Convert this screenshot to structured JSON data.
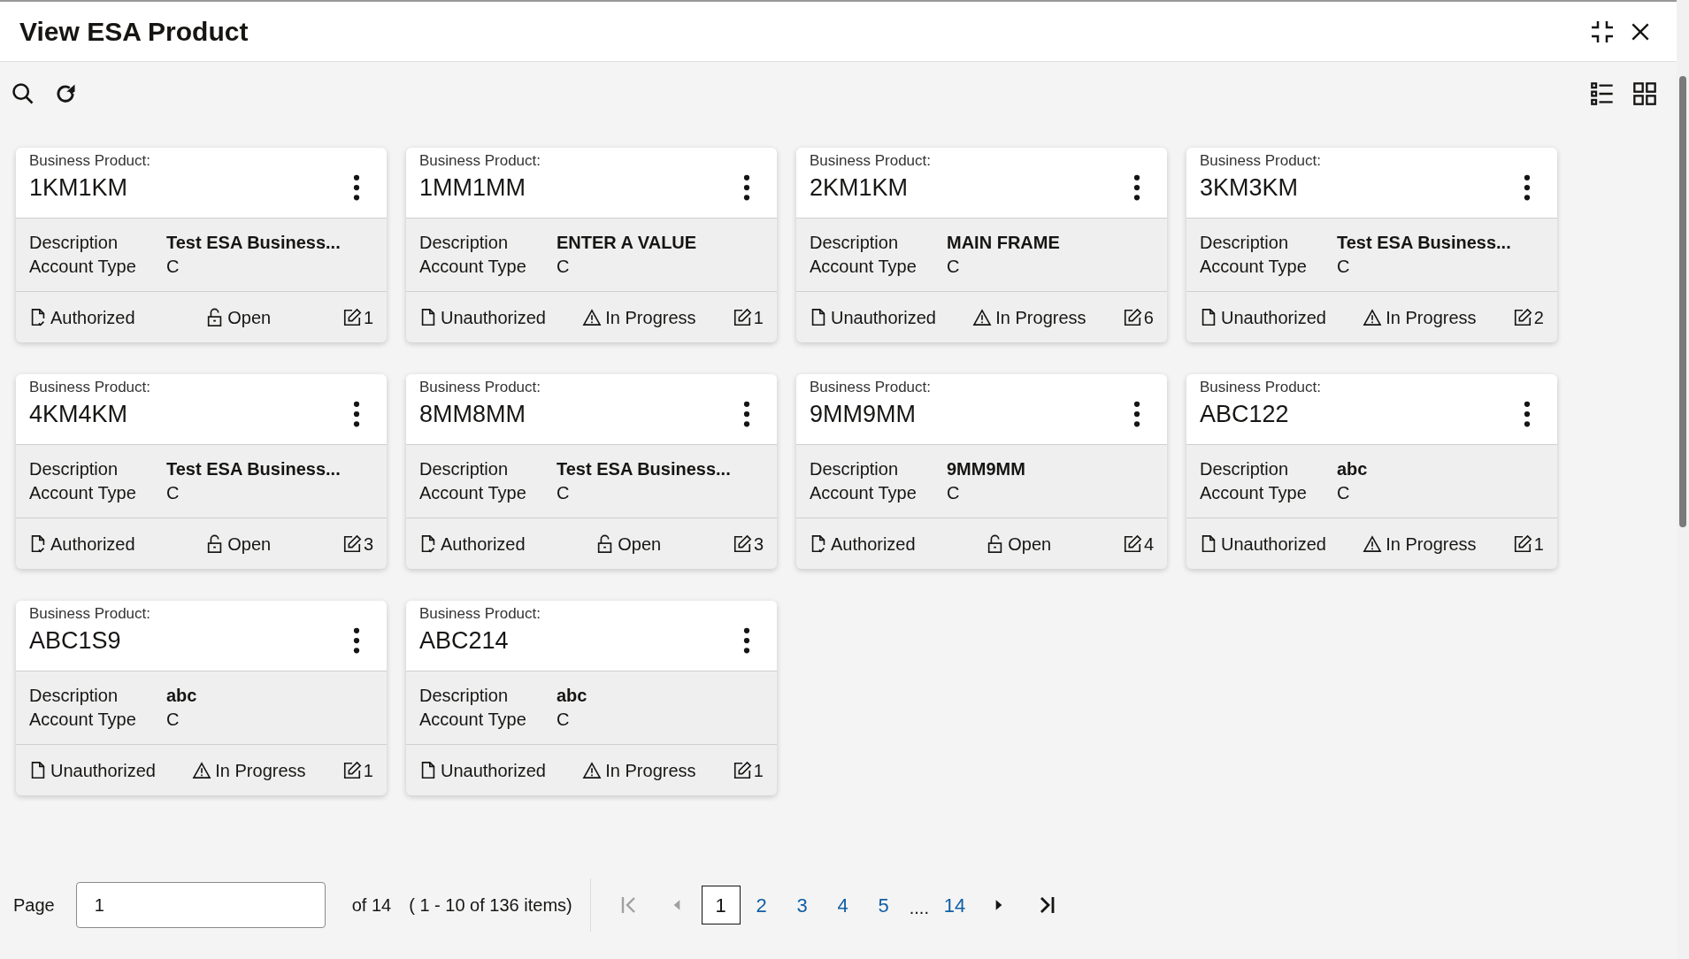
{
  "window": {
    "title": "View ESA Product"
  },
  "cards": [
    {
      "label": "Business Product:",
      "product": "1KM1KM",
      "description_label": "Description",
      "description": "Test ESA Business...",
      "account_type_label": "Account Type",
      "account_type": "C",
      "auth": {
        "kind": "authorized",
        "text": "Authorized"
      },
      "status": {
        "kind": "open",
        "text": "Open"
      },
      "edits": "1"
    },
    {
      "label": "Business Product:",
      "product": "1MM1MM",
      "description_label": "Description",
      "description": "ENTER A VALUE",
      "account_type_label": "Account Type",
      "account_type": "C",
      "auth": {
        "kind": "unauthorized",
        "text": "Unauthorized"
      },
      "status": {
        "kind": "in_progress",
        "text": "In Progress"
      },
      "edits": "1"
    },
    {
      "label": "Business Product:",
      "product": "2KM1KM",
      "description_label": "Description",
      "description": "MAIN FRAME",
      "account_type_label": "Account Type",
      "account_type": "C",
      "auth": {
        "kind": "unauthorized",
        "text": "Unauthorized"
      },
      "status": {
        "kind": "in_progress",
        "text": "In Progress"
      },
      "edits": "6"
    },
    {
      "label": "Business Product:",
      "product": "3KM3KM",
      "description_label": "Description",
      "description": "Test ESA Business...",
      "account_type_label": "Account Type",
      "account_type": "C",
      "auth": {
        "kind": "unauthorized",
        "text": "Unauthorized"
      },
      "status": {
        "kind": "in_progress",
        "text": "In Progress"
      },
      "edits": "2"
    },
    {
      "label": "Business Product:",
      "product": "4KM4KM",
      "description_label": "Description",
      "description": "Test ESA Business...",
      "account_type_label": "Account Type",
      "account_type": "C",
      "auth": {
        "kind": "authorized",
        "text": "Authorized"
      },
      "status": {
        "kind": "open",
        "text": "Open"
      },
      "edits": "3"
    },
    {
      "label": "Business Product:",
      "product": "8MM8MM",
      "description_label": "Description",
      "description": "Test ESA Business...",
      "account_type_label": "Account Type",
      "account_type": "C",
      "auth": {
        "kind": "authorized",
        "text": "Authorized"
      },
      "status": {
        "kind": "open",
        "text": "Open"
      },
      "edits": "3"
    },
    {
      "label": "Business Product:",
      "product": "9MM9MM",
      "description_label": "Description",
      "description": "9MM9MM",
      "account_type_label": "Account Type",
      "account_type": "C",
      "auth": {
        "kind": "authorized",
        "text": "Authorized"
      },
      "status": {
        "kind": "open",
        "text": "Open"
      },
      "edits": "4"
    },
    {
      "label": "Business Product:",
      "product": "ABC122",
      "description_label": "Description",
      "description": "abc",
      "account_type_label": "Account Type",
      "account_type": "C",
      "auth": {
        "kind": "unauthorized",
        "text": "Unauthorized"
      },
      "status": {
        "kind": "in_progress",
        "text": "In Progress"
      },
      "edits": "1"
    },
    {
      "label": "Business Product:",
      "product": "ABC1S9",
      "description_label": "Description",
      "description": "abc",
      "account_type_label": "Account Type",
      "account_type": "C",
      "auth": {
        "kind": "unauthorized",
        "text": "Unauthorized"
      },
      "status": {
        "kind": "in_progress",
        "text": "In Progress"
      },
      "edits": "1"
    },
    {
      "label": "Business Product:",
      "product": "ABC214",
      "description_label": "Description",
      "description": "abc",
      "account_type_label": "Account Type",
      "account_type": "C",
      "auth": {
        "kind": "unauthorized",
        "text": "Unauthorized"
      },
      "status": {
        "kind": "in_progress",
        "text": "In Progress"
      },
      "edits": "1"
    }
  ],
  "pagination": {
    "page_label": "Page",
    "page_value": "1",
    "of_text": "of 14",
    "range_text": "( 1 - 10 of 136 items)",
    "first_disabled": true,
    "prev_disabled": true,
    "pages": [
      {
        "label": "1",
        "selected": true
      },
      {
        "label": "2",
        "selected": false
      },
      {
        "label": "3",
        "selected": false
      },
      {
        "label": "4",
        "selected": false
      },
      {
        "label": "5",
        "selected": false
      },
      {
        "label": "....",
        "kind": "ellipsis"
      },
      {
        "label": "14",
        "selected": false
      }
    ]
  }
}
